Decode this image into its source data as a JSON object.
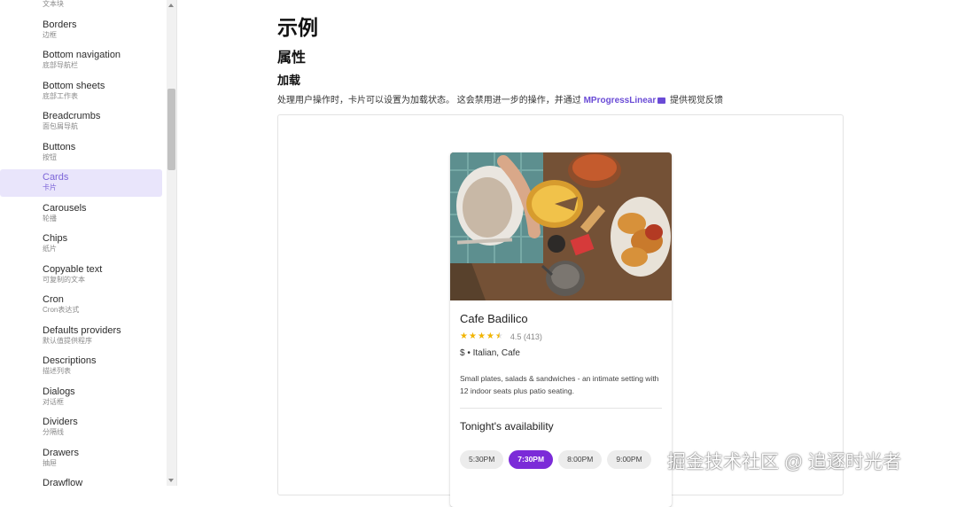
{
  "sidebar": {
    "top_cut_label": "文本块",
    "items": [
      {
        "en": "Borders",
        "zh": "边框"
      },
      {
        "en": "Bottom navigation",
        "zh": "底部导航栏"
      },
      {
        "en": "Bottom sheets",
        "zh": "底部工作表"
      },
      {
        "en": "Breadcrumbs",
        "zh": "面包屑导航"
      },
      {
        "en": "Buttons",
        "zh": "按钮"
      },
      {
        "en": "Cards",
        "zh": "卡片"
      },
      {
        "en": "Carousels",
        "zh": "轮播"
      },
      {
        "en": "Chips",
        "zh": "纸片"
      },
      {
        "en": "Copyable text",
        "zh": "可复制的文本"
      },
      {
        "en": "Cron",
        "zh": "Cron表达式"
      },
      {
        "en": "Defaults providers",
        "zh": "默认值提供程序"
      },
      {
        "en": "Descriptions",
        "zh": "描述列表"
      },
      {
        "en": "Dialogs",
        "zh": "对话框"
      },
      {
        "en": "Dividers",
        "zh": "分隔线"
      },
      {
        "en": "Drawers",
        "zh": "抽屉"
      },
      {
        "en": "Drawflow",
        "zh": ""
      }
    ],
    "active_item": "Cards"
  },
  "main": {
    "heading_example": "示例",
    "heading_props": "属性",
    "heading_loading": "加载",
    "description_prefix": "处理用户操作时，卡片可以设置为加载状态。 这会禁用进一步的操作，并通过",
    "description_link": "MProgressLinear",
    "description_suffix": "提供视觉反馈"
  },
  "card": {
    "title": "Cafe Badilico",
    "rating_value": 4.5,
    "rating_text": "4.5 (413)",
    "price_category": "$ • Italian, Cafe",
    "description": "Small plates, salads & sandwiches - an intimate setting with 12 indoor seats plus patio seating.",
    "availability_title": "Tonight's availability",
    "times": [
      "5:30PM",
      "7:30PM",
      "8:00PM",
      "9:00PM"
    ],
    "selected_time": "7:30PM",
    "accent_color": "#7b2bd8",
    "star_color": "#f1b400"
  },
  "watermark": "掘金技术社区 @ 追逐时光者"
}
